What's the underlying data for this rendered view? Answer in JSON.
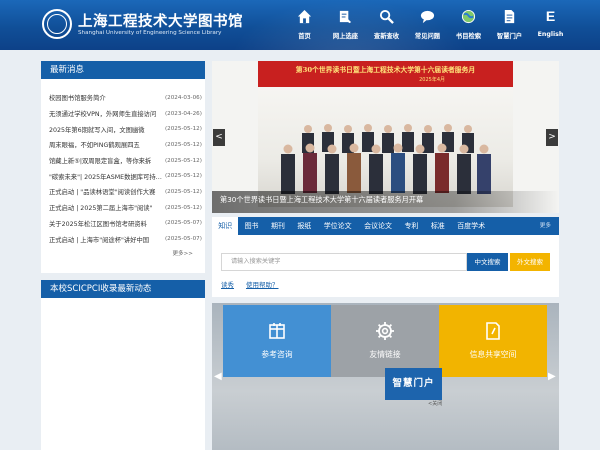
{
  "header": {
    "title": "上海工程技术大学图书馆",
    "subtitle": "Shanghai University of Engineering Science Library",
    "nav": [
      {
        "label": "首页",
        "icon": "home-icon"
      },
      {
        "label": "网上选座",
        "icon": "seat-select-icon"
      },
      {
        "label": "查新查收",
        "icon": "magnifier-icon"
      },
      {
        "label": "常见问题",
        "icon": "chat-bubble-icon"
      },
      {
        "label": "书目检索",
        "icon": "globe-icon"
      },
      {
        "label": "智慧门户",
        "icon": "document-icon"
      },
      {
        "label": "English",
        "glyph": "E"
      }
    ]
  },
  "news": {
    "title": "最新消息",
    "items": [
      {
        "title": "校园图书馆服务简介",
        "date": "(2024-03-06)"
      },
      {
        "title": "无须通过学校VPN，外网师生直接访问",
        "date": "(2023-04-26)"
      },
      {
        "title": "2025年第6期就写入间，文图幽微",
        "date": "(2025-05-12)"
      },
      {
        "title": "周末眼福，不如PING鹤观展四五",
        "date": "(2025-05-12)"
      },
      {
        "title": "馆藏上新⑤|双周限定盲盒，等你来拆",
        "date": "(2025-05-12)"
      },
      {
        "title": "\"碳索未来\"| 2025年ASME数据库可持续发展",
        "date": "(2025-05-12)"
      },
      {
        "title": "正式启动 | \"品读林语堂\"阅读创作大赛",
        "date": "(2025-05-12)"
      },
      {
        "title": "正式启动 | 2025第二届上海市\"阅读\"",
        "date": "(2025-05-12)"
      },
      {
        "title": "关于2025年松江区图书馆考研资料",
        "date": "(2025-05-07)"
      },
      {
        "title": "正式启动 | 上海市\"阅途杯\"讲好中国",
        "date": "(2025-05-07)"
      }
    ],
    "more": "更多>>"
  },
  "sci": {
    "title": "本校SCICPCI收录最新动态"
  },
  "banner": {
    "photo_title": "第30个世界读书日暨上海工程技术大学第十六届读者服务月",
    "photo_date": "2025年4月",
    "caption": "第30个世界读书日暨上海工程技术大学第十六届读者服务月开幕",
    "prev": "<",
    "next": ">"
  },
  "search": {
    "tabs": [
      "知识",
      "图书",
      "期刊",
      "报纸",
      "学位论文",
      "会议论文",
      "专利",
      "标准",
      "百度学术"
    ],
    "more": "更多",
    "placeholder": "请输入搜索关键字",
    "btn_cn": "中文搜索",
    "btn_en": "外文搜索",
    "link1": "读秀",
    "link2": "使用帮助？"
  },
  "portal": {
    "tiles": [
      {
        "label": "参考咨询",
        "icon": "consult-icon"
      },
      {
        "label": "友情链接",
        "icon": "gear-icon"
      },
      {
        "label": "信息共享空间",
        "icon": "share-space-icon"
      }
    ],
    "smart": "智慧门户",
    "smart_note": "<关闭",
    "prev": "◀",
    "next": "▶"
  },
  "colors": {
    "brand": "#155fa8",
    "header": "#104f98",
    "accent": "#f3b400",
    "banner_red": "#c8201f"
  }
}
